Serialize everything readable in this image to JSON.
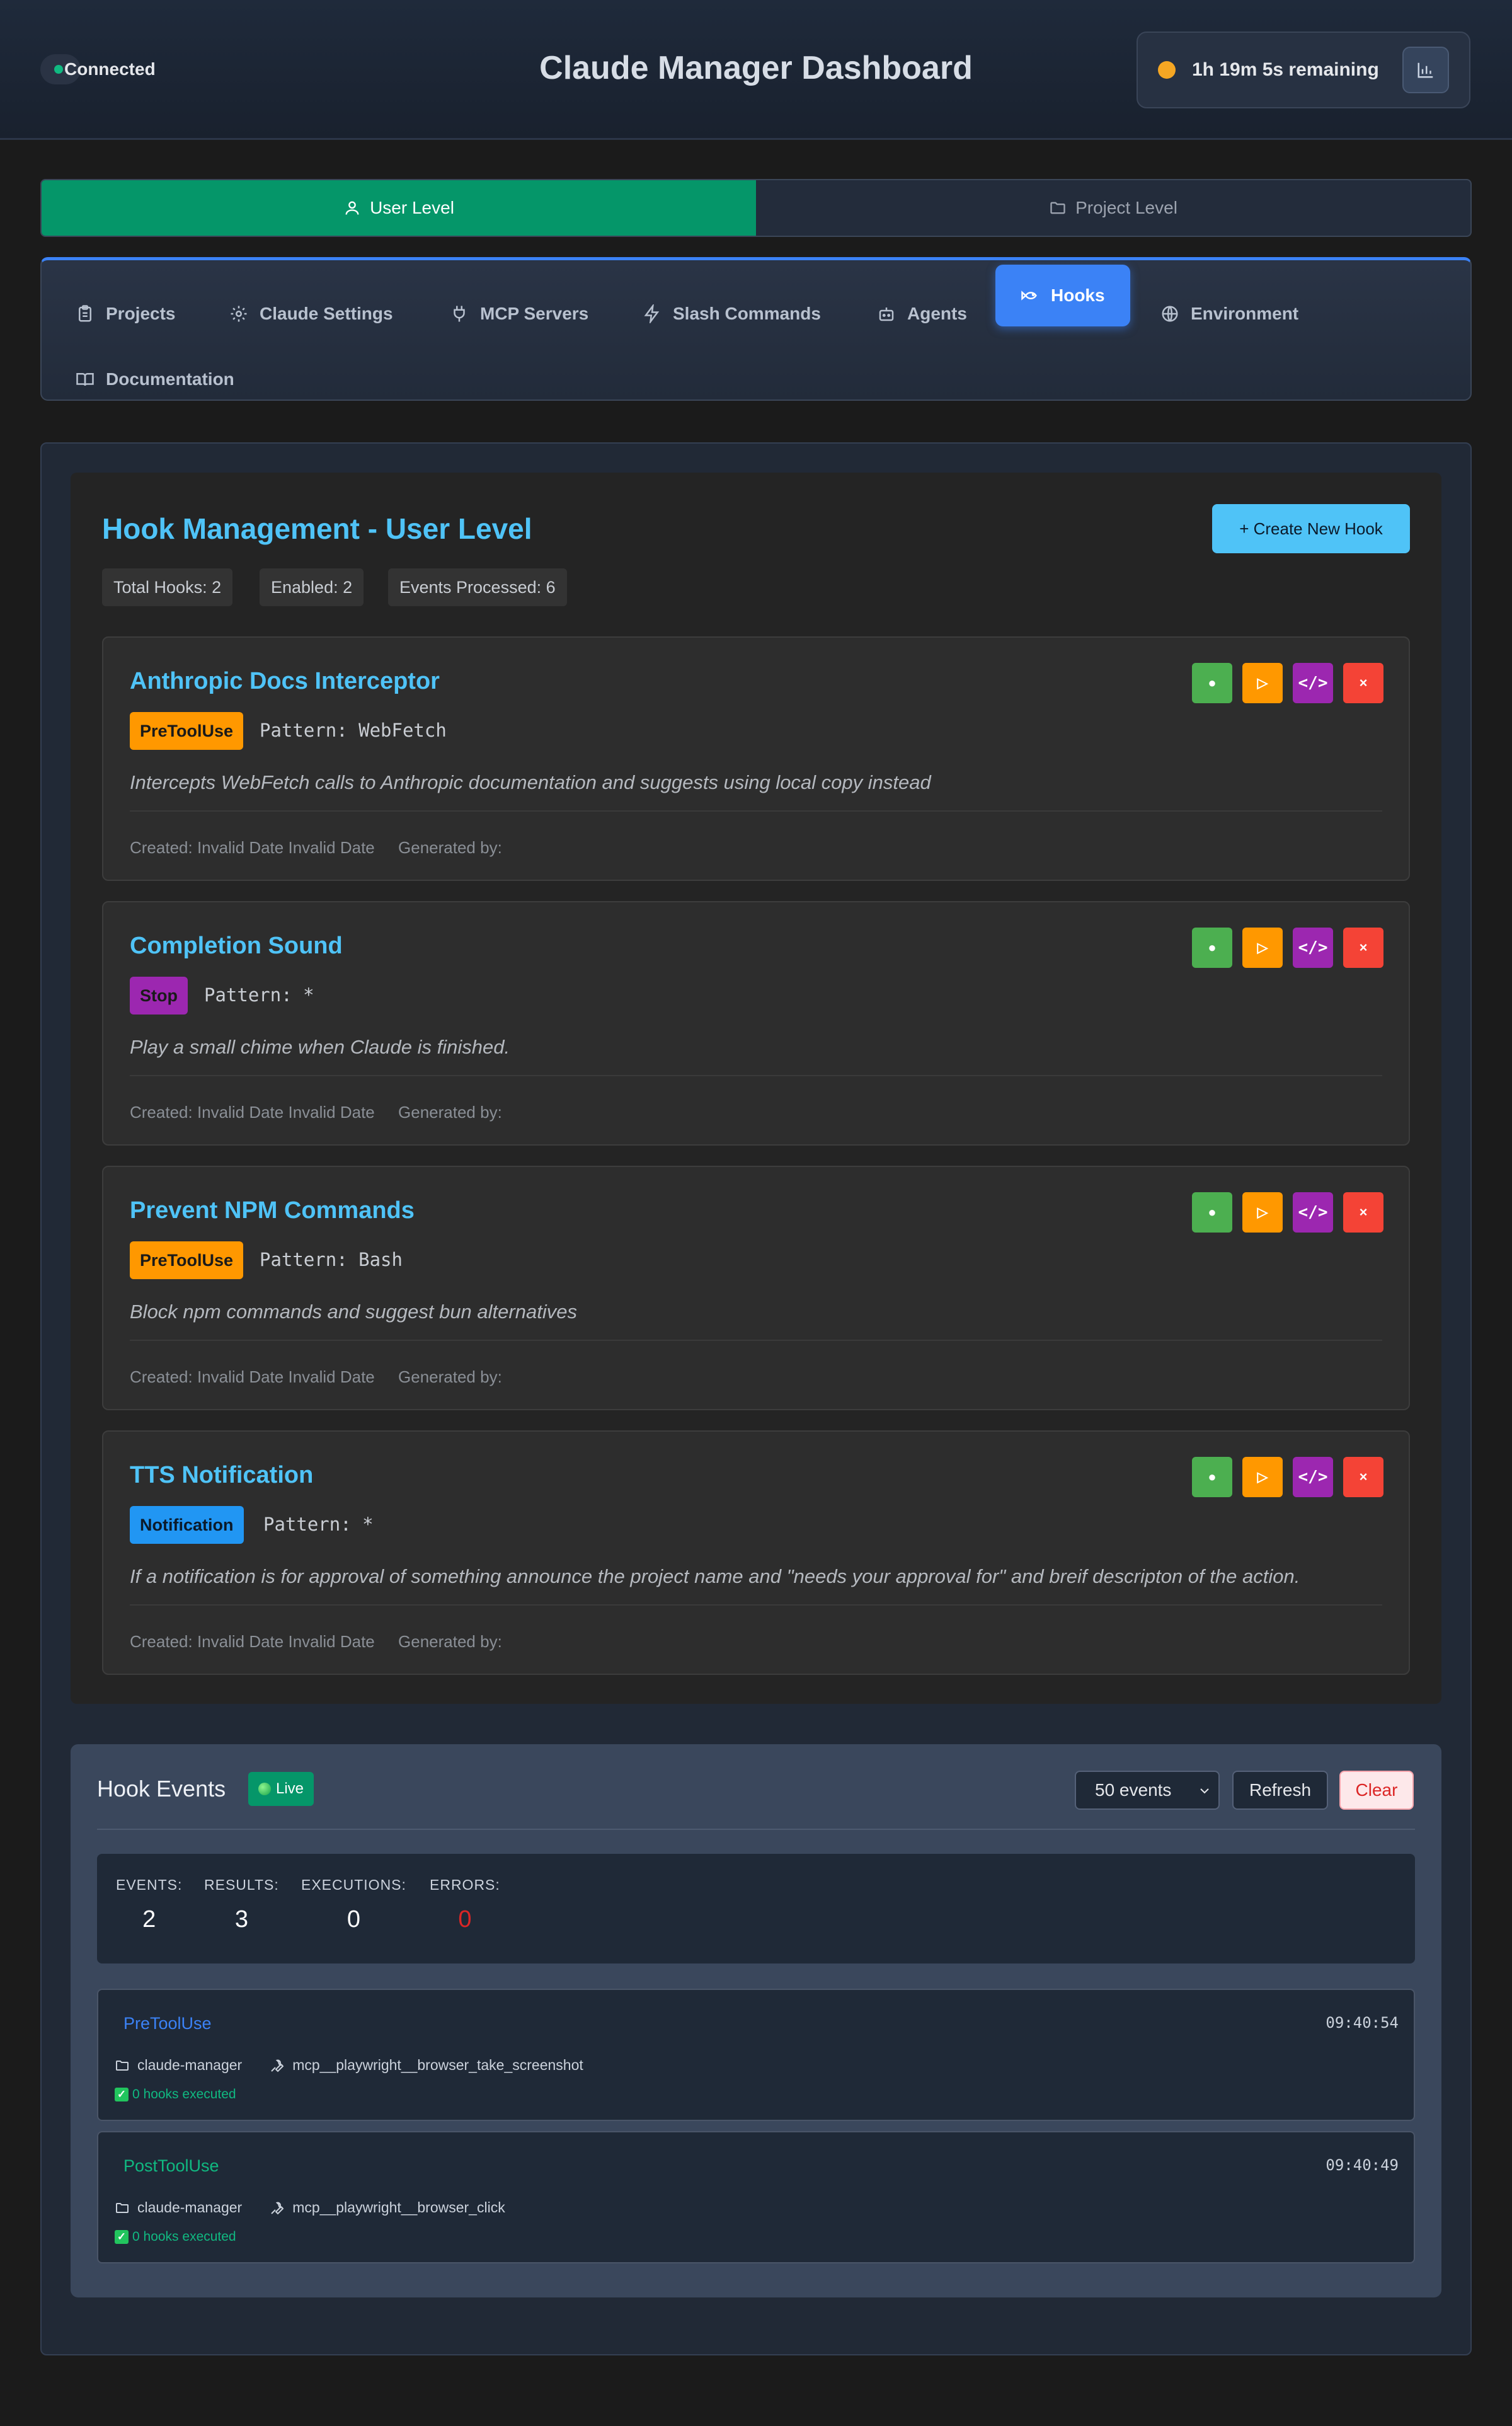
{
  "header": {
    "connection_status": "Connected",
    "title": "Claude Manager Dashboard",
    "timer_text": "1h 19m 5s remaining",
    "timer_button_icon": "bar-chart-icon"
  },
  "level_toggle": {
    "user": "User Level",
    "project": "Project Level",
    "active": "user"
  },
  "tabs": [
    {
      "label": "Projects",
      "icon": "clipboard-icon"
    },
    {
      "label": "Claude Settings",
      "icon": "gear-icon"
    },
    {
      "label": "MCP Servers",
      "icon": "plug-icon"
    },
    {
      "label": "Slash Commands",
      "icon": "lightning-icon"
    },
    {
      "label": "Agents",
      "icon": "robot-icon"
    },
    {
      "label": "Hooks",
      "icon": "fish-icon",
      "active": true
    },
    {
      "label": "Environment",
      "icon": "globe-icon"
    },
    {
      "label": "Documentation",
      "icon": "book-icon"
    }
  ],
  "hooks_panel": {
    "title": "Hook Management - User Level",
    "create_button": "+ Create New Hook",
    "stats": {
      "total": "Total Hooks: 2",
      "enabled": "Enabled: 2",
      "events": "Events Processed: 6"
    },
    "hooks": [
      {
        "name": "Anthropic Docs Interceptor",
        "event": "PreToolUse",
        "pattern": "Pattern: WebFetch",
        "description": "Intercepts WebFetch calls to Anthropic documentation and suggests using local copy instead",
        "created": "Created: Invalid Date Invalid Date",
        "generated": "Generated by:"
      },
      {
        "name": "Completion Sound",
        "event": "Stop",
        "pattern": "Pattern: *",
        "description": "Play a small chime when Claude is finished.",
        "created": "Created: Invalid Date Invalid Date",
        "generated": "Generated by:"
      },
      {
        "name": "Prevent NPM Commands",
        "event": "PreToolUse",
        "pattern": "Pattern: Bash",
        "description": "Block npm commands and suggest bun alternatives",
        "created": "Created: Invalid Date Invalid Date",
        "generated": "Generated by:"
      },
      {
        "name": "TTS Notification",
        "event": "Notification",
        "pattern": "Pattern: *",
        "description": "If a notification is for approval of something announce the project name and \"needs your approval for\" and breif descripton of the action.",
        "created": "Created: Invalid Date Invalid Date",
        "generated": "Generated by:"
      }
    ],
    "card_buttons": {
      "toggle": "●",
      "test": "▷",
      "code": "</>",
      "delete": "×"
    }
  },
  "events_panel": {
    "title": "Hook Events",
    "live_label": "Live",
    "limit_select": "50 events",
    "refresh": "Refresh",
    "clear": "Clear",
    "stats": [
      {
        "label": "EVENTS:",
        "value": "2"
      },
      {
        "label": "RESULTS:",
        "value": "3"
      },
      {
        "label": "EXECUTIONS:",
        "value": "0"
      },
      {
        "label": "ERRORS:",
        "value": "0"
      }
    ],
    "items": [
      {
        "type": "PreToolUse",
        "time": "09:40:54",
        "project": "claude-manager",
        "tool": "mcp__playwright__browser_take_screenshot",
        "executed": "0 hooks executed"
      },
      {
        "type": "PostToolUse",
        "time": "09:40:49",
        "project": "claude-manager",
        "tool": "mcp__playwright__browser_click",
        "executed": "0 hooks executed"
      }
    ]
  },
  "colors": {
    "accent": "#4fc3f7",
    "active_tab": "#3b82f6",
    "level_active": "#059669",
    "pretooluse": "#ff9800",
    "stop": "#9c27b0",
    "notification": "#2196f3",
    "error": "#dc2626"
  }
}
